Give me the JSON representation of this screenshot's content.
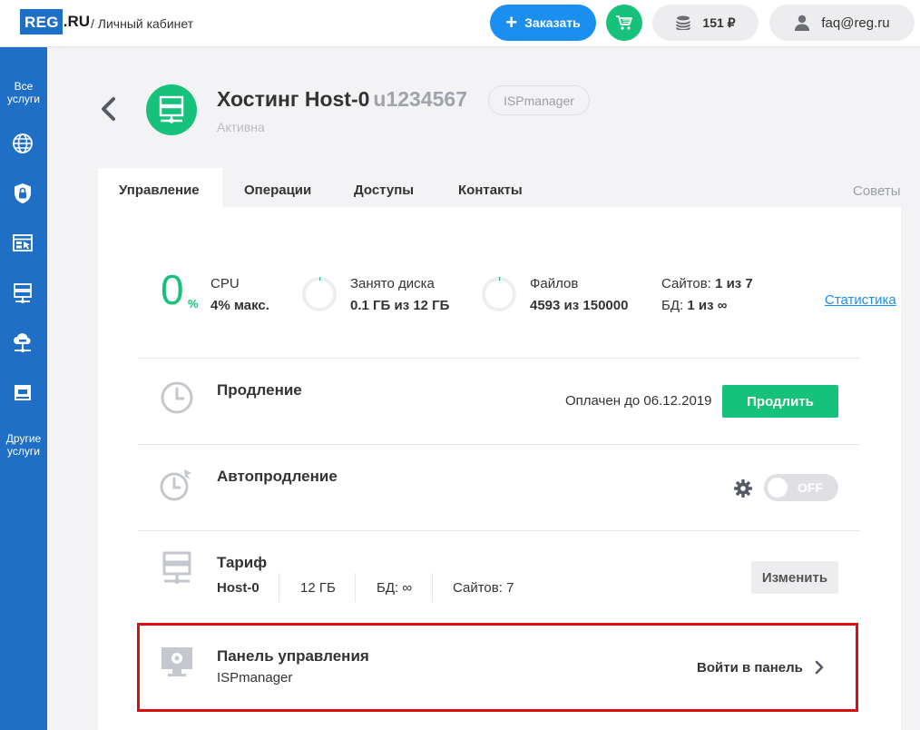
{
  "header": {
    "logo_text": "REG",
    "logo_suffix": ".RU",
    "breadcrumb": "/ Личный кабинет",
    "order_label": "Заказать",
    "balance": "151 ₽",
    "user_email": "faq@reg.ru"
  },
  "sidebar": {
    "all_services": [
      "Все",
      "услуги"
    ],
    "other_services": [
      "Другие",
      "услуги"
    ],
    "icons": [
      "globe-icon",
      "shield-lock-icon",
      "window-cursor-icon",
      "server-icon",
      "cloud-server-icon",
      "monitor-icon"
    ]
  },
  "service": {
    "title": "Хостинг Host-0",
    "uid": "u1234567",
    "tag": "ISPmanager",
    "status": "Активна"
  },
  "tabs": [
    "Управление",
    "Операции",
    "Доступы",
    "Контакты"
  ],
  "tips_label": "Советы",
  "stats": {
    "cpu_value": "0",
    "cpu_unit": "%",
    "cpu_label": "CPU",
    "cpu_max": "4% макс.",
    "disk_label": "Занято диска",
    "disk_value": "0.1 ГБ из 12 ГБ",
    "files_label": "Файлов",
    "files_value": "4593 из 150000",
    "sites_label": "Сайтов:",
    "sites_value": "1 из 7",
    "db_label": "БД:",
    "db_value": "1 из ∞",
    "stats_link": "Статистика"
  },
  "renewal": {
    "title": "Продление",
    "paid_until": "Оплачен до 06.12.2019",
    "button": "Продлить"
  },
  "autorenew": {
    "title": "Автопродление",
    "toggle_state": "OFF"
  },
  "tariff": {
    "title": "Тариф",
    "name": "Host-0",
    "disk": "12 ГБ",
    "db": "БД: ∞",
    "sites": "Сайтов: 7",
    "button": "Изменить"
  },
  "control_panel": {
    "title": "Панель управления",
    "subtitle": "ISPmanager",
    "button": "Войти в панель"
  },
  "colors": {
    "brand_blue": "#1f6fc6",
    "accent_green": "#16c27b",
    "link_blue": "#1a8ff0",
    "highlight_red": "#dd0e0e"
  }
}
